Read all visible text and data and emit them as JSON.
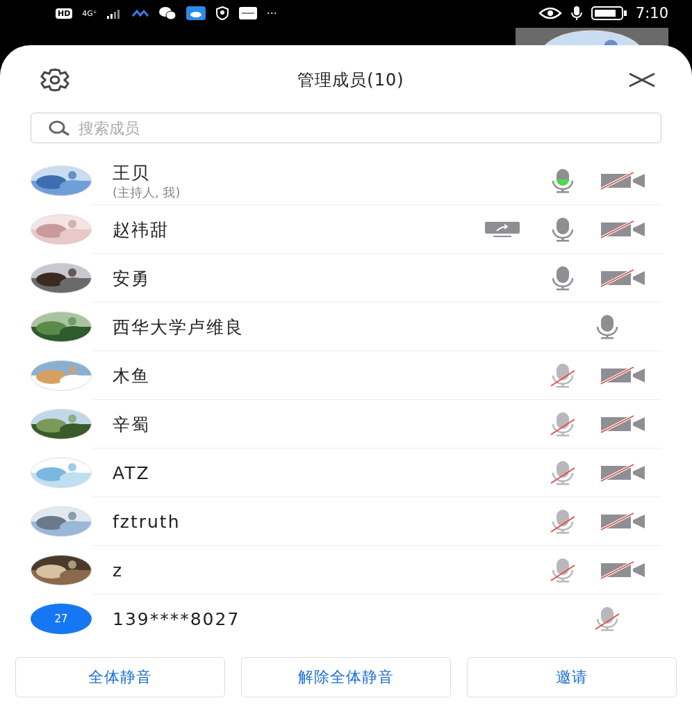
{
  "status_bar": {
    "network_badge": "HD",
    "network": "4G⁺",
    "more": "···",
    "time": "7:10"
  },
  "header": {
    "title": "管理成员(10)"
  },
  "search": {
    "placeholder": "搜索成员"
  },
  "members": [
    {
      "name": "王贝",
      "subtitle": "(主持人, 我)",
      "share": false,
      "mic_muted": false,
      "speaking": true,
      "camera_shown": true,
      "camera_muted": true
    },
    {
      "name": "赵祎甜",
      "share": true,
      "mic_muted": false,
      "speaking": false,
      "camera_shown": true,
      "camera_muted": true
    },
    {
      "name": "安勇",
      "share": false,
      "mic_muted": false,
      "speaking": false,
      "camera_shown": true,
      "camera_muted": true
    },
    {
      "name": "西华大学卢维良",
      "share": false,
      "mic_muted": false,
      "speaking": false,
      "camera_shown": false
    },
    {
      "name": "木鱼",
      "share": false,
      "mic_muted": true,
      "speaking": false,
      "camera_shown": true,
      "camera_muted": true
    },
    {
      "name": "辛蜀",
      "share": false,
      "mic_muted": true,
      "speaking": false,
      "camera_shown": true,
      "camera_muted": true
    },
    {
      "name": "ATZ",
      "share": false,
      "mic_muted": true,
      "speaking": false,
      "camera_shown": true,
      "camera_muted": true
    },
    {
      "name": "fztruth",
      "share": false,
      "mic_muted": true,
      "speaking": false,
      "camera_shown": true,
      "camera_muted": true
    },
    {
      "name": "z",
      "share": false,
      "mic_muted": true,
      "speaking": false,
      "camera_shown": true,
      "camera_muted": true
    },
    {
      "name": "139****8027",
      "avatar": {
        "kind": "badge",
        "label": "27"
      },
      "share": false,
      "mic_muted": true,
      "speaking": false,
      "camera_shown": false
    }
  ],
  "buttons": [
    "全体静音",
    "解除全体静音",
    "邀请"
  ]
}
